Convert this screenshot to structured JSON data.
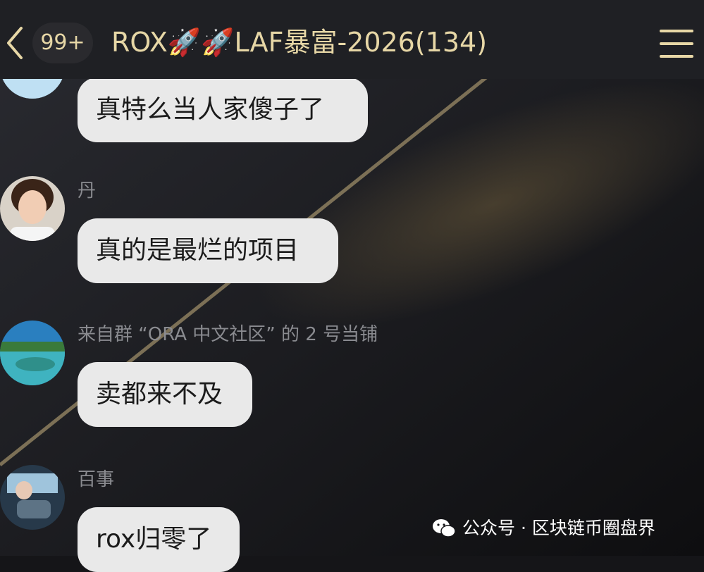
{
  "header": {
    "unread_badge": "99+",
    "title": "ROX🚀🚀LAF暴富-2026(134)"
  },
  "messages": [
    {
      "sender": "",
      "text": "真特么当人家傻子了"
    },
    {
      "sender": "丹",
      "text": "真的是最烂的项目"
    },
    {
      "sender": "来自群 “ORA 中文社区” 的 2 号当铺",
      "text": "卖都来不及"
    },
    {
      "sender": "百事",
      "text": "rox归零了"
    }
  ],
  "watermark": {
    "text": "公众号 · 区块链币圈盘界"
  },
  "colors": {
    "accent": "#e7d7a6",
    "bubble": "#e9e9e9",
    "background": "#151518"
  }
}
